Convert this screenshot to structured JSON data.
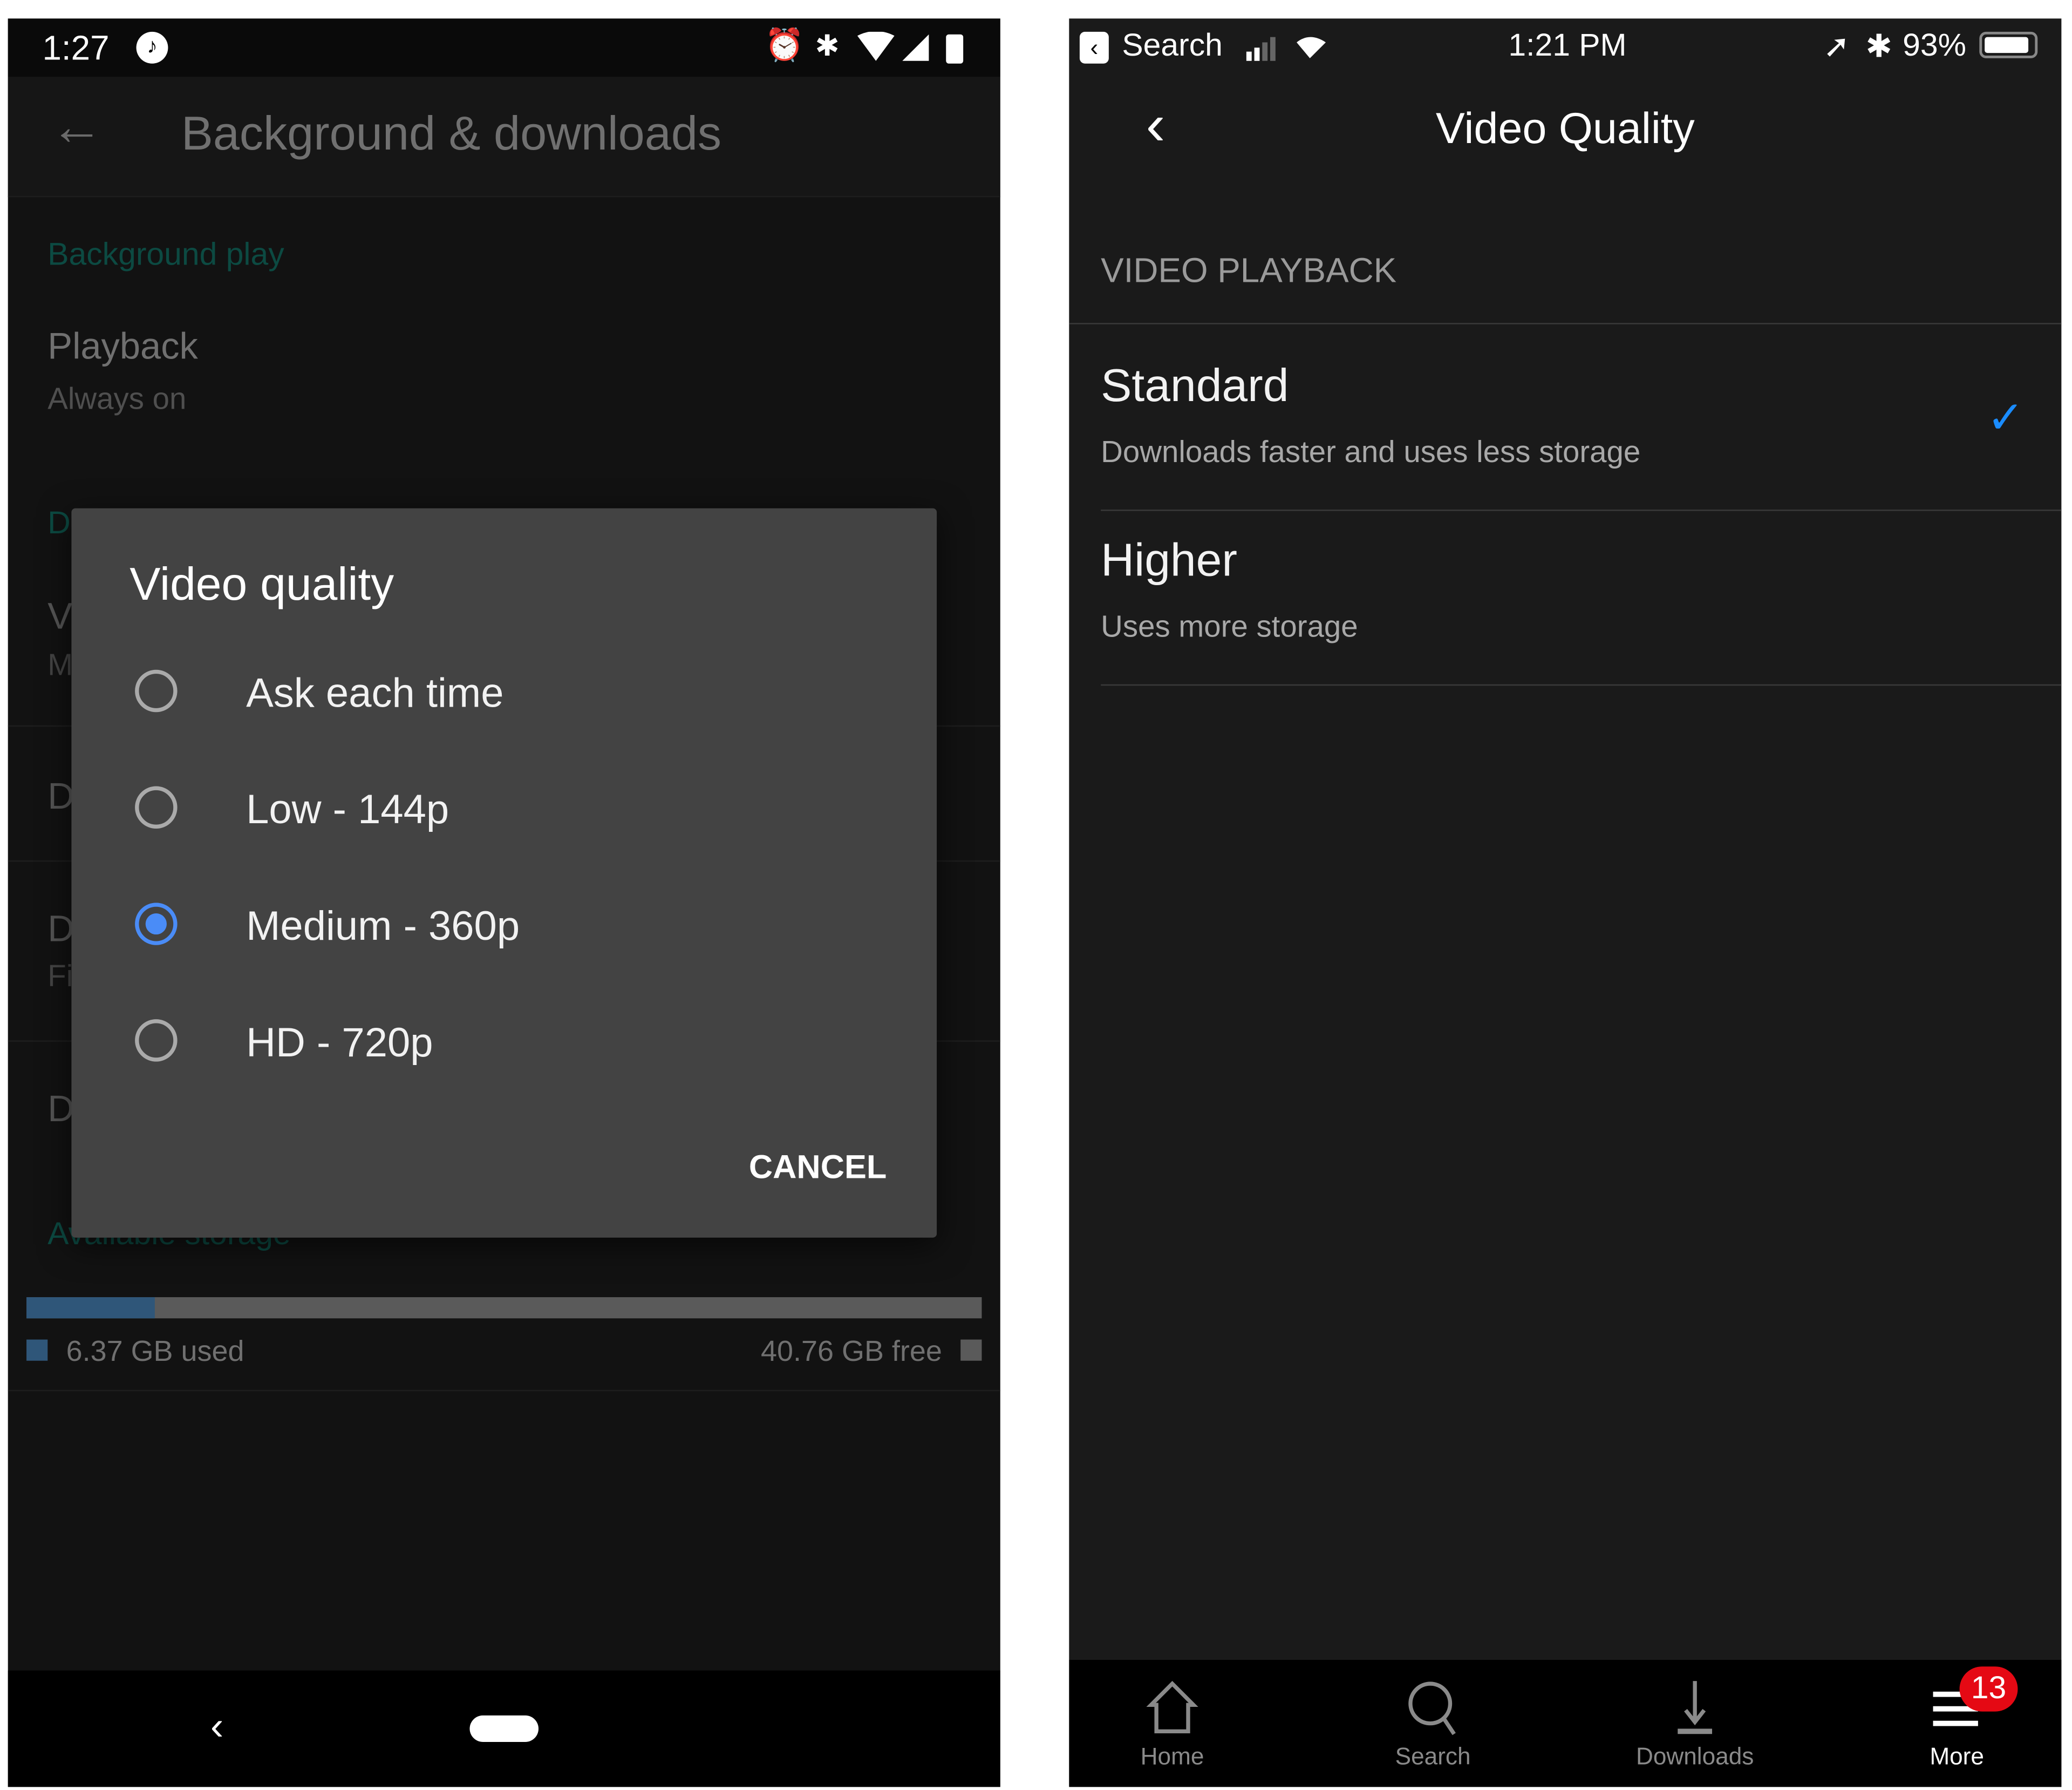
{
  "android": {
    "status_bar": {
      "time": "1:27",
      "icons": [
        "music-app-icon",
        "alarm-icon",
        "bluetooth-icon",
        "wifi-icon",
        "signal-icon",
        "battery-icon"
      ]
    },
    "app_bar": {
      "title": "Background & downloads",
      "back_icon": "arrow-left-icon"
    },
    "settings": {
      "background_section": "Background play",
      "playback_title": "Playback",
      "playback_value": "Always on",
      "obscured_fragments": [
        "D",
        "V",
        "M",
        "D",
        "D",
        "Fi",
        "D"
      ],
      "storage_section": "Available storage",
      "storage_used": "6.37 GB used",
      "storage_free": "40.76 GB free",
      "storage_used_fraction": 0.135,
      "used_color": "#2f5679",
      "free_color": "#5a5a5a"
    },
    "dialog": {
      "title": "Video quality",
      "options": [
        {
          "label": "Ask each time",
          "selected": false
        },
        {
          "label": "Low - 144p",
          "selected": false
        },
        {
          "label": "Medium - 360p",
          "selected": true
        },
        {
          "label": "HD - 720p",
          "selected": false
        }
      ],
      "cancel_label": "CANCEL",
      "accent": "#4a8cf7"
    }
  },
  "ios": {
    "status_bar": {
      "back_app": "Search",
      "time": "1:21 PM",
      "battery": "93%"
    },
    "nav": {
      "title": "Video Quality"
    },
    "section_header": "VIDEO PLAYBACK",
    "options": [
      {
        "title": "Standard",
        "subtitle": "Downloads faster and uses less storage",
        "selected": true
      },
      {
        "title": "Higher",
        "subtitle": "Uses more storage",
        "selected": false
      }
    ],
    "check_color": "#1a8cff",
    "tabs": [
      {
        "label": "Home",
        "icon": "home-icon"
      },
      {
        "label": "Search",
        "icon": "search-icon"
      },
      {
        "label": "Downloads",
        "icon": "download-icon"
      },
      {
        "label": "More",
        "icon": "menu-icon",
        "badge": "13",
        "active": true
      }
    ],
    "badge_color": "#e50914"
  }
}
